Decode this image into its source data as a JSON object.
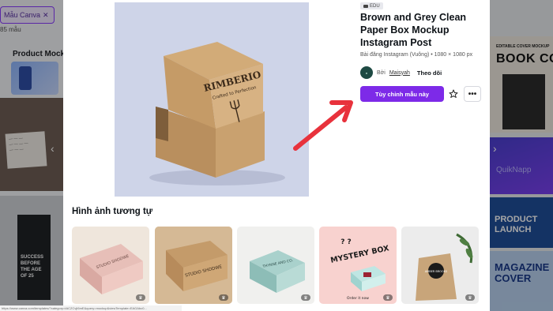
{
  "background": {
    "filter_chip": "Mẫu Canva",
    "result_count": "85 mẫu",
    "section_title": "Product Mockups",
    "left_card_text": "SUCCESS BEFORE THE AGE OF 25",
    "right_card1_small": "EDITABLE COVER MOCKUP",
    "right_card1_big": "BOOK COVE",
    "right_card2_text": "QuikNapp",
    "right_card3_text": "PRODUCT LAUNCH",
    "right_card4_text": "MAGAZINE COVER"
  },
  "modal": {
    "badge": "EDU",
    "title": "Brown and Grey Clean Paper Box Mockup Instagram Post",
    "subtitle": "Bài đăng Instagram (Vuông) • 1080 × 1080 px",
    "by_label": "Bởi",
    "author": "Maisyah",
    "follow_label": "Theo dõi",
    "cta_label": "Tùy chỉnh mẫu này",
    "more_label": "•••",
    "similar_title": "Hình ảnh tương tự",
    "preview": {
      "brand": "RIMBERIO",
      "tagline": "Crafted to Perfection"
    },
    "similar": [
      {
        "label": "STUDIO SHODWE"
      },
      {
        "label": "STUDIO SHODWE"
      },
      {
        "label": "THYNNE AND CO."
      },
      {
        "label": "MYSTERY BOX",
        "sub": "Order it now"
      },
      {
        "label": "AMBER BROOKS"
      }
    ]
  },
  "statusbar": {
    "url": "https://www.canva.com/templates/?category=tACZCvjI6mE&query=mockup&viewTemplate=EAGAbc0..."
  },
  "colors": {
    "accent": "#7d2ae8",
    "arrow": "#e8323c"
  }
}
